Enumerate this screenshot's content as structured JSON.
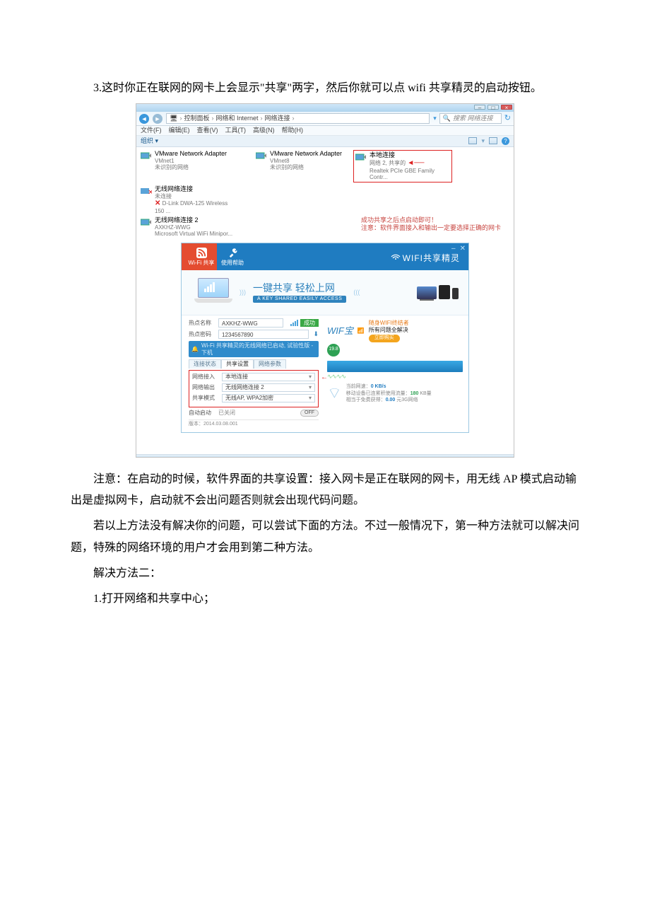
{
  "doc": {
    "p1": "3.这时你正在联网的网卡上会显示\"共享\"两字，然后你就可以点 wifi 共享精灵的启动按钮。",
    "p2a": "注意：在启动的时候，软件界面的共享设置：接入网卡是正在联网的网卡，用无线 AP 模式启动输出是虚拟网卡，启动就不会出问题否则就会出现代码问题。",
    "p3a": "若以上方法没有解决你的问题，可以尝试下面的方法。不过一般情况下，第一种方法就可以解决问题，特殊的网络环境的用户才会用到第二种方法。",
    "p4": "解决方法二：",
    "p5": "1.打开网络和共享中心；"
  },
  "win": {
    "crumbs": {
      "c1": "控制面板",
      "c2": "网络和 Internet",
      "c3": "网络连接"
    },
    "search_ph": "搜索 网络连接",
    "menu": {
      "file": "文件(F)",
      "edit": "编辑(E)",
      "view": "查看(V)",
      "tools": "工具(T)",
      "adv": "高级(N)",
      "help": "帮助(H)"
    },
    "org": "组织 ▾",
    "adapters": {
      "a1": {
        "t1": "VMware Network Adapter",
        "t2": "VMnet1",
        "t3": "未识别的网络"
      },
      "a2": {
        "t1": "VMware Network Adapter",
        "t2": "VMnet8",
        "t3": "未识别的网络"
      },
      "a3": {
        "t1": "本地连接",
        "t2": "网络 2, 共享的",
        "t3": "Realtek PCIe GBE Family Contr..."
      },
      "a4": {
        "t1": "无线网络连接",
        "t2": "未连接",
        "t3": "D-Link DWA-125 Wireless 150 ..."
      },
      "a5": {
        "t1": "无线网络连接 2",
        "t2": "AXKHZ-WWG",
        "t3": "Microsoft Virtual WiFi Minipor..."
      }
    },
    "status": {
      "l1": "成功共享之后点启动即可！",
      "l2": "注意：软件界面接入和输出一定要选择正确的网卡"
    }
  },
  "app": {
    "tabs": {
      "wifi": "Wi-Fi 共享",
      "help": "使用帮助"
    },
    "logo": "WIFI共享精灵",
    "banner": {
      "cn": "一键共享 轻松上网",
      "en": "A KEY SHARED EASILY ACCESS"
    },
    "form": {
      "name_lbl": "热点名称",
      "name_val": "AXKHZ-WWG",
      "pw_lbl": "热点密码",
      "pw_val": "1234567890",
      "ok": "成功",
      "strip": "Wi-Fi 共享精灵的无线网络已启动, 试验性版 - 下机"
    },
    "subtabs": {
      "t1": "连接状态",
      "t2": "共享设置",
      "t3": "网络参数"
    },
    "settings": {
      "in_lbl": "网络接入",
      "in_val": "本地连接",
      "out_lbl": "网络输出",
      "out_val": "无线网络连接 2",
      "mode_lbl": "共享模式",
      "mode_val": "无线AP, WPA2加密",
      "auto_lbl": "自动启动",
      "auto_val": "已关闭",
      "off": "OFF"
    },
    "version": "版本：2014.03.08.001",
    "promo": {
      "tag": "WIF宝",
      "line1": "随身WIFI终结者",
      "line2": "所有问题全解决",
      "btn": "立即购买"
    },
    "stats": {
      "s1a": "当前网速：",
      "s1b": "0 KB/s",
      "s2a": "移动设备已连累积使用流量：",
      "s2b": "180",
      "s2c": " KB量",
      "s3a": "相当于免费获得：",
      "s3b": "0.00",
      "s3c": " 元3G网络"
    }
  }
}
